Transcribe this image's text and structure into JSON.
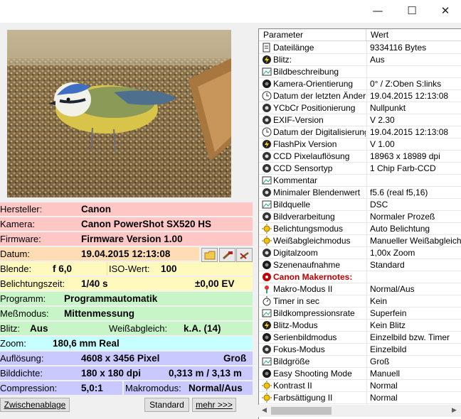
{
  "window": {
    "minimize_glyph": "—",
    "maximize_glyph": "☐",
    "close_glyph": "✕"
  },
  "info": {
    "hersteller_label": "Hersteller:",
    "hersteller_value": "Canon",
    "kamera_label": "Kamera:",
    "kamera_value": "Canon PowerShot SX520 HS",
    "firmware_label": "Firmware:",
    "firmware_value": "Firmware Version 1.00",
    "datum_label": "Datum:",
    "datum_value": "19.04.2015 12:13:08",
    "blende_label": "Blende:",
    "blende_value": "f 6,0",
    "iso_label": "ISO-Wert:",
    "iso_value": "100",
    "belichtung_label": "Belichtungszeit:",
    "belichtung_value": "1/40 s",
    "ev_value": "±0,00 EV",
    "programm_label": "Programm:",
    "programm_value": "Programmautomatik",
    "messmodus_label": "Meßmodus:",
    "messmodus_value": "Mittenmessung",
    "blitz_label": "Blitz:",
    "blitz_value": "Aus",
    "weiss_label": "Weißabgleich:",
    "weiss_value": "k.A. (14)",
    "zoom_label": "Zoom:",
    "zoom_value": "180,6 mm Real",
    "aufloesung_label": "Auflösung:",
    "aufloesung_value": "4608 x 3456 Pixel",
    "groesse_value": "Groß",
    "dichte_label": "Bilddichte:",
    "dichte_value": "180 x 180 dpi",
    "dichte_metric": "0,313 m / 3,13 m",
    "compression_label": "Compression:",
    "compression_value": "5,0:1",
    "makro_label": "Makromodus:",
    "makro_value": "Normal/Aus"
  },
  "buttons": {
    "zwischenablage": "Zwischenablage",
    "standard": "Standard",
    "mehr": "mehr >>>"
  },
  "table": {
    "headers": [
      "Parameter",
      "Wert"
    ],
    "rows": [
      {
        "icon": "file-icon",
        "param": "Dateilänge",
        "value": "9334116 Bytes"
      },
      {
        "icon": "flash-icon",
        "param": "Blitz:",
        "value": "Aus"
      },
      {
        "icon": "image-icon",
        "param": "Bildbeschreibung",
        "value": ""
      },
      {
        "icon": "camera-icon",
        "param": "Kamera-Orientierung",
        "value": "0° / Z:Oben S:links"
      },
      {
        "icon": "clock-icon",
        "param": "Datum der letzten Änder...",
        "value": "19.04.2015 12:13:08"
      },
      {
        "icon": "gear-icon",
        "param": "YCbCr Positionierung",
        "value": "Nullpunkt"
      },
      {
        "icon": "gear-icon",
        "param": "EXIF-Version",
        "value": "V 2.30"
      },
      {
        "icon": "clock-icon",
        "param": "Datum der Digitalisierung",
        "value": "19.04.2015 12:13:08"
      },
      {
        "icon": "flash-icon",
        "param": "FlashPix Version",
        "value": "V 1.00"
      },
      {
        "icon": "gear-icon",
        "param": "CCD Pixelauflösung",
        "value": "18963 x 18989 dpi"
      },
      {
        "icon": "gear-icon",
        "param": "CCD Sensortyp",
        "value": "1 Chip Farb-CCD"
      },
      {
        "icon": "image-icon",
        "param": "Kommentar",
        "value": ""
      },
      {
        "icon": "gear-icon",
        "param": "Minimaler Blendenwert",
        "value": "f5.6 (real f5,16)"
      },
      {
        "icon": "image-icon",
        "param": "Bildquelle",
        "value": "DSC"
      },
      {
        "icon": "gear-icon",
        "param": "Bildverarbeitung",
        "value": "Normaler Prozeß"
      },
      {
        "icon": "sun-icon",
        "param": "Belichtungsmodus",
        "value": "Auto Belichtung"
      },
      {
        "icon": "sun-icon",
        "param": "Weißabgleichmodus",
        "value": "Manueller Weißabgleich"
      },
      {
        "icon": "gear-icon",
        "param": "Digitalzoom",
        "value": "1,00x Zoom"
      },
      {
        "icon": "camera-icon",
        "param": "Szenenaufnahme",
        "value": "Standard"
      },
      {
        "icon": "canon-icon",
        "param": "Canon Makernotes:",
        "value": "",
        "section": true
      },
      {
        "icon": "flower-icon",
        "param": "Makro-Modus II",
        "value": "Normal/Aus"
      },
      {
        "icon": "timer-icon",
        "param": "Timer in sec",
        "value": "Kein"
      },
      {
        "icon": "image-icon",
        "param": "Bildkompressionsrate",
        "value": "Superfein"
      },
      {
        "icon": "flash-icon",
        "param": "Blitz-Modus",
        "value": "Kein Blitz"
      },
      {
        "icon": "camera-icon",
        "param": "Serienbildmodus",
        "value": "Einzelbild bzw. Timer"
      },
      {
        "icon": "gear-icon",
        "param": "Fokus-Modus",
        "value": "Einzelbild"
      },
      {
        "icon": "image-icon",
        "param": "Bildgröße",
        "value": "Groß"
      },
      {
        "icon": "camera-icon",
        "param": "Easy Shooting Mode",
        "value": "Manuell"
      },
      {
        "icon": "sun-icon",
        "param": "Kontrast II",
        "value": "Normal"
      },
      {
        "icon": "sun-icon",
        "param": "Farbsättigung II",
        "value": "Normal"
      }
    ]
  }
}
